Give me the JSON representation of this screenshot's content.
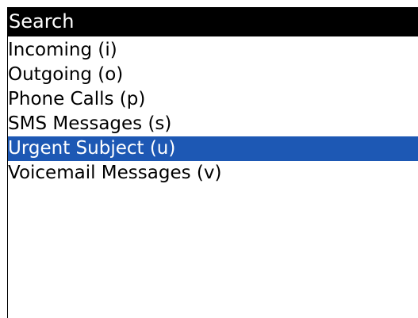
{
  "window": {
    "title": "Search"
  },
  "menu": {
    "items": [
      {
        "label": "Incoming (i)",
        "selected": false
      },
      {
        "label": "Outgoing (o)",
        "selected": false
      },
      {
        "label": "Phone Calls (p)",
        "selected": false
      },
      {
        "label": "SMS Messages (s)",
        "selected": false
      },
      {
        "label": "Urgent Subject (u)",
        "selected": true
      },
      {
        "label": "Voicemail Messages (v)",
        "selected": false
      }
    ]
  },
  "colors": {
    "title_bar_bg": "#000000",
    "title_bar_text": "#ffffff",
    "selection_bg": "#1d58b4",
    "selection_text": "#ffffff",
    "background": "#ffffff",
    "text": "#000000"
  }
}
